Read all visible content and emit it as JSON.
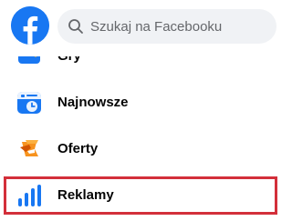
{
  "search": {
    "placeholder": "Szukaj na Facebooku"
  },
  "nav": {
    "items": [
      {
        "label": "Gry",
        "icon": "games-icon"
      },
      {
        "label": "Najnowsze",
        "icon": "most-recent-icon"
      },
      {
        "label": "Oferty",
        "icon": "offers-icon"
      },
      {
        "label": "Reklamy",
        "icon": "ads-manager-icon"
      }
    ]
  },
  "colors": {
    "brand": "#1877f2",
    "highlight": "#d32f3a",
    "search_bg": "#f0f2f5"
  }
}
